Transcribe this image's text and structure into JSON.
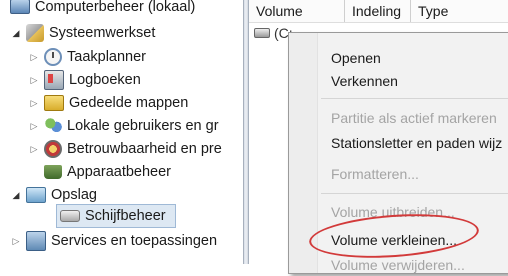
{
  "tree": {
    "items": [
      {
        "label": "Computerbeheer (lokaal)",
        "icon": "computer-icon",
        "expander": "",
        "level": 0
      },
      {
        "label": "Systeemwerkset",
        "icon": "tools-icon",
        "expander": "◢",
        "level": 1
      },
      {
        "label": "Taakplanner",
        "icon": "clock-icon",
        "expander": "▷",
        "level": 2
      },
      {
        "label": "Logboeken",
        "icon": "event-viewer-icon",
        "expander": "▷",
        "level": 2
      },
      {
        "label": "Gedeelde mappen",
        "icon": "shared-folder-icon",
        "expander": "▷",
        "level": 2
      },
      {
        "label": "Lokale gebruikers en gr",
        "icon": "users-icon",
        "expander": "▷",
        "level": 2
      },
      {
        "label": "Betrouwbaarheid en pre",
        "icon": "performance-icon",
        "expander": "▷",
        "level": 2
      },
      {
        "label": "Apparaatbeheer",
        "icon": "device-manager-icon",
        "expander": "",
        "level": 2
      },
      {
        "label": "Opslag",
        "icon": "storage-icon",
        "expander": "◢",
        "level": 1
      },
      {
        "label": "Schijfbeheer",
        "icon": "disk-icon",
        "expander": "",
        "level": 2
      },
      {
        "label": "Services en toepassingen",
        "icon": "services-icon",
        "expander": "▷",
        "level": 1
      }
    ]
  },
  "list": {
    "columns": [
      "Volume",
      "Indeling",
      "Type"
    ],
    "row0": "(C:"
  },
  "context_menu": {
    "items": [
      {
        "label": "Openen",
        "disabled": false
      },
      {
        "label": "Verkennen",
        "disabled": false
      },
      {
        "label": "Partitie als actief markeren",
        "disabled": true
      },
      {
        "label": "Stationsletter en paden wijz",
        "disabled": false
      },
      {
        "label": "Formatteren...",
        "disabled": true
      },
      {
        "label": "Volume uitbreiden...",
        "disabled": true
      },
      {
        "label": "Volume verkleinen...",
        "disabled": false,
        "highlighted": true
      },
      {
        "label": "Volume verwijderen...",
        "disabled": true
      }
    ]
  },
  "colors": {
    "highlight_circle": "#d23a3a",
    "selection": "#dde8f3"
  }
}
